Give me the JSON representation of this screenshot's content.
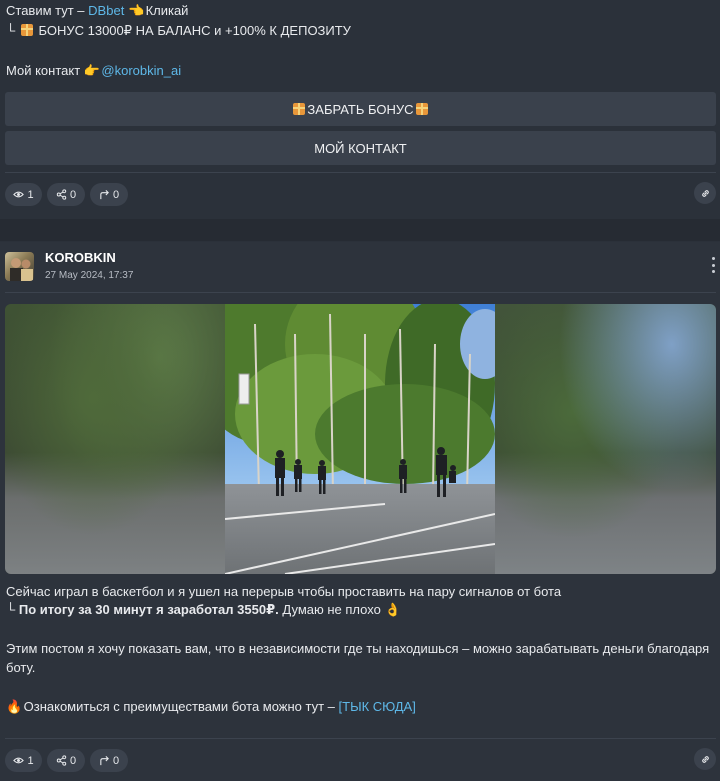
{
  "post1": {
    "line1_prefix": "Ставим тут –",
    "line1_link": "DBbet",
    "line1_suffix": "Кликай",
    "line2_prefix": "└",
    "line2_text": "БОНУС 13000₽ НА БАЛАНС и +100% К ДЕПОЗИТУ",
    "contact_prefix": "Мой контакт",
    "contact_handle": "@korobkin_ai",
    "buttons": {
      "bonus_label": "ЗАБРАТЬ БОНУС",
      "contact_label": "МОЙ КОНТАКТ"
    },
    "stats": {
      "views": "1",
      "shares": "0",
      "forwards": "0"
    }
  },
  "post2": {
    "author": "KOROBKIN",
    "date": "27 May 2024, 17:37",
    "text1": "Сейчас играл в баскетбол и я ушел на перерыв чтобы проставить на пару сигналов от бота",
    "text2_prefix": "└",
    "text2_bold": "По итогу за 30 минут я заработал 3550₽.",
    "text2_rest": "Думаю не плохо",
    "text3_line1": "Этим постом я хочу показать вам, что в независимости где ты находишься – можно зарабатывать деньги благодаря",
    "text3_line2": "боту.",
    "text4_prefix": "Ознакомиться с преимуществами бота можно тут –",
    "text4_link": "[ТЫК СЮДА]",
    "stats": {
      "views": "1",
      "shares": "0",
      "forwards": "0"
    }
  },
  "colors": {
    "background": "#2b313a",
    "link": "#5eb8e8",
    "button": "#3a414c"
  },
  "icons": [
    "pointing-hand-icon",
    "gift-icon",
    "eye-icon",
    "share-icon",
    "forward-icon",
    "link-icon",
    "fire-icon",
    "ok-hand-icon",
    "more-vertical-icon"
  ]
}
